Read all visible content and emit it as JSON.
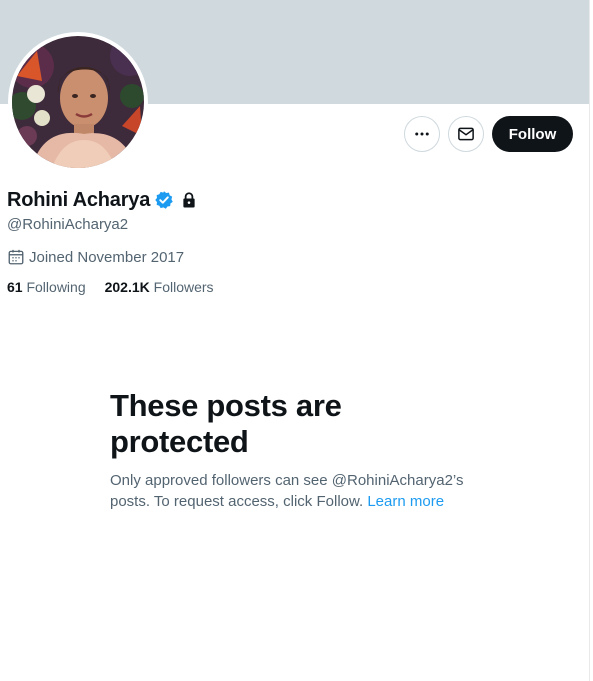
{
  "profile": {
    "name": "Rohini Acharya",
    "handle": "@RohiniAcharya2",
    "joined": "Joined November 2017",
    "verified": true,
    "protected_account": true
  },
  "stats": {
    "following_count": "61",
    "following_label": "Following",
    "followers_count": "202.1K",
    "followers_label": "Followers"
  },
  "actions": {
    "follow_label": "Follow",
    "more_icon": "more-horizontal-icon",
    "message_icon": "envelope-icon"
  },
  "protected_notice": {
    "title_line1": "These posts are",
    "title_line2": "protected",
    "body_prefix": "Only approved followers can see @RohiniAcharya2’s posts. To request access, click Follow. ",
    "link_text": "Learn more"
  },
  "colors": {
    "banner": "#cfd9de",
    "verified_blue": "#1d9bf0",
    "link": "#1d9bf0",
    "primary_text": "#0f1419",
    "secondary_text": "#536471",
    "follow_button_bg": "#0f1419"
  }
}
